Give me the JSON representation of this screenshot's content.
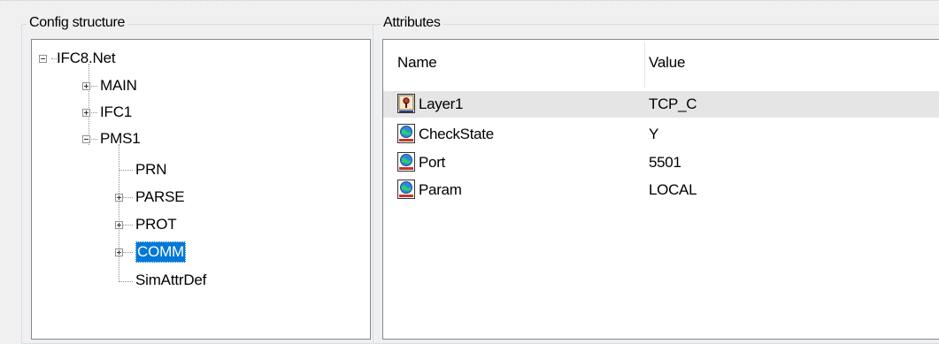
{
  "config_panel": {
    "title": "Config structure",
    "tree": [
      {
        "label": "IFC8.Net",
        "expander": "minus"
      },
      {
        "label": "MAIN",
        "expander": "plus"
      },
      {
        "label": "IFC1",
        "expander": "plus"
      },
      {
        "label": "PMS1",
        "expander": "minus"
      },
      {
        "label": "PRN",
        "expander": "none"
      },
      {
        "label": "PARSE",
        "expander": "plus"
      },
      {
        "label": "PROT",
        "expander": "plus"
      },
      {
        "label": "COMM",
        "expander": "plus",
        "selected": true
      },
      {
        "label": "SimAttrDef",
        "expander": "none"
      }
    ]
  },
  "attributes_panel": {
    "title": "Attributes",
    "columns": [
      "Name",
      "Value"
    ],
    "rows": [
      {
        "name": "Layer1",
        "value": "TCP_C",
        "icon": "attribute-key-icon",
        "highlight": true
      },
      {
        "name": "CheckState",
        "value": "Y",
        "icon": "attribute-globe-icon"
      },
      {
        "name": "Port",
        "value": "5501",
        "icon": "attribute-globe-icon"
      },
      {
        "name": "Param",
        "value": "LOCAL",
        "icon": "attribute-globe-icon"
      }
    ]
  },
  "colors": {
    "selection": "#0078d7",
    "row_highlight": "#e5e5e5",
    "window_bg": "#f0f0f0"
  }
}
